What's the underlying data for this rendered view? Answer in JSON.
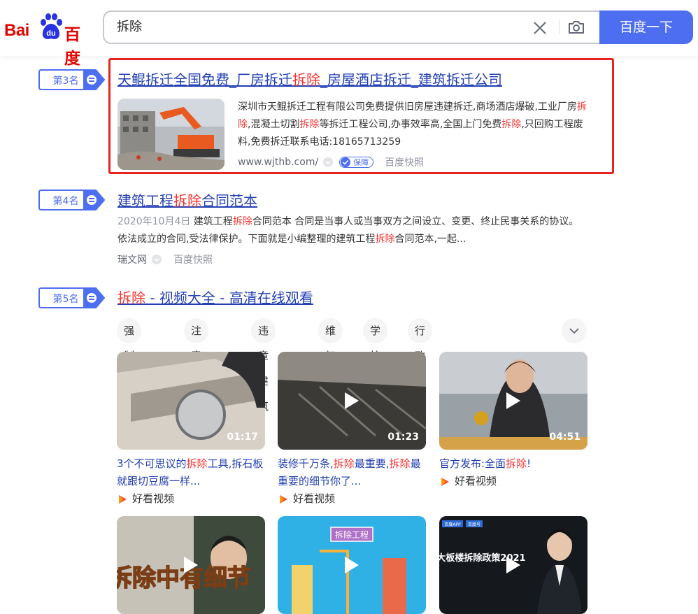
{
  "header": {
    "logo_latin": "Bai",
    "logo_du": "du",
    "logo_cn": "百度",
    "query": "拆除",
    "search_button": "百度一下"
  },
  "results": [
    {
      "rank": "第3名",
      "title_parts": [
        "天鲲拆迁全国免费_厂房拆迁",
        "拆除",
        "_房屋酒店拆迁_建筑拆迁公司"
      ],
      "desc_parts": [
        "深圳市天鲲拆迁工程有限公司免费提供旧房屋违建拆迁,商场酒店爆破,工业厂房",
        "拆除",
        ",混凝土切割",
        "拆除",
        "等拆迁工程公司,办事效率高,全国上门免费",
        "拆除",
        ",只回购工程废料,免费拆迁联系电话:18165713259"
      ],
      "url": "www.wjthb.com/",
      "badge": "保障",
      "snapshot": "百度快照"
    },
    {
      "rank": "第4名",
      "title_parts": [
        "建筑工程",
        "拆除",
        "合同范本"
      ],
      "date": "2020年10月4日",
      "desc_parts": [
        " 建筑工程",
        "拆除",
        "合同范本 合同是当事人或当事双方之间设立、变更、终止民事关系的协议。依法成立的合同,受法律保护。下面就是小编整理的建筑工程",
        "拆除",
        "合同范本,一起..."
      ],
      "source": "瑞文网",
      "snapshot": "百度快照"
    },
    {
      "rank": "第5名",
      "title_parts": [
        "拆除",
        " - 视频大全 - 高清在线观看"
      ],
      "tags": [
        "强制拆迁",
        "注意安全",
        "违章建筑",
        "维权",
        "学校",
        "行政强制法"
      ],
      "videos": [
        {
          "title_parts": [
            "3个不可思议的",
            "拆除",
            "工具,拆石板就跟切豆腐一样..."
          ],
          "duration": "01:17",
          "source": "好看视频"
        },
        {
          "title_parts": [
            "装修千万条,",
            "拆除",
            "最重要,",
            "拆除",
            "最重要的细节你了..."
          ],
          "duration": "01:23",
          "source": "好看视频"
        },
        {
          "title_parts": [
            "官方发布:全面",
            "拆除",
            "!"
          ],
          "duration": "04:51",
          "source": "好看视频"
        }
      ],
      "bottom_video_texts": [
        "拆除中有细节",
        "拆除工程",
        "百度APP",
        "百度号",
        "大板楼拆除政策2021"
      ]
    }
  ],
  "colors": {
    "brand_blue": "#4e6ef2",
    "link_blue": "#2440b3",
    "highlight_red": "#f73131",
    "logo_red": "#e10602",
    "annotation_red": "#e8221f"
  }
}
